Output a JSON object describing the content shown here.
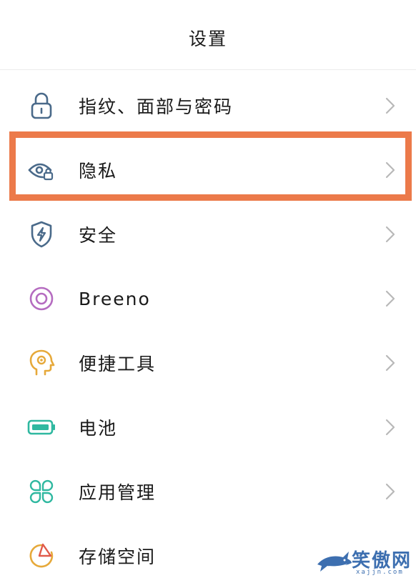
{
  "header": {
    "title": "设置"
  },
  "items": [
    {
      "label": "指纹、面部与密码",
      "icon": "lock-icon",
      "color": "#4a6a8a"
    },
    {
      "label": "隐私",
      "icon": "eye-lock-icon",
      "color": "#4a6a8a"
    },
    {
      "label": "安全",
      "icon": "shield-bolt-icon",
      "color": "#4a6a8a"
    },
    {
      "label": "Breeno",
      "icon": "breeno-icon",
      "color": "#b56cc0"
    },
    {
      "label": "便捷工具",
      "icon": "head-gear-icon",
      "color": "#e6a93a"
    },
    {
      "label": "电池",
      "icon": "battery-icon",
      "color": "#2fb8a0"
    },
    {
      "label": "应用管理",
      "icon": "apps-grid-icon",
      "color": "#2fb8a0"
    },
    {
      "label": "存储空间",
      "icon": "pie-chart-icon",
      "color": "#e6a93a"
    }
  ],
  "highlight_color": "#ec7a4a",
  "watermark": {
    "text": "笑傲网",
    "url": "xajjn.com"
  }
}
